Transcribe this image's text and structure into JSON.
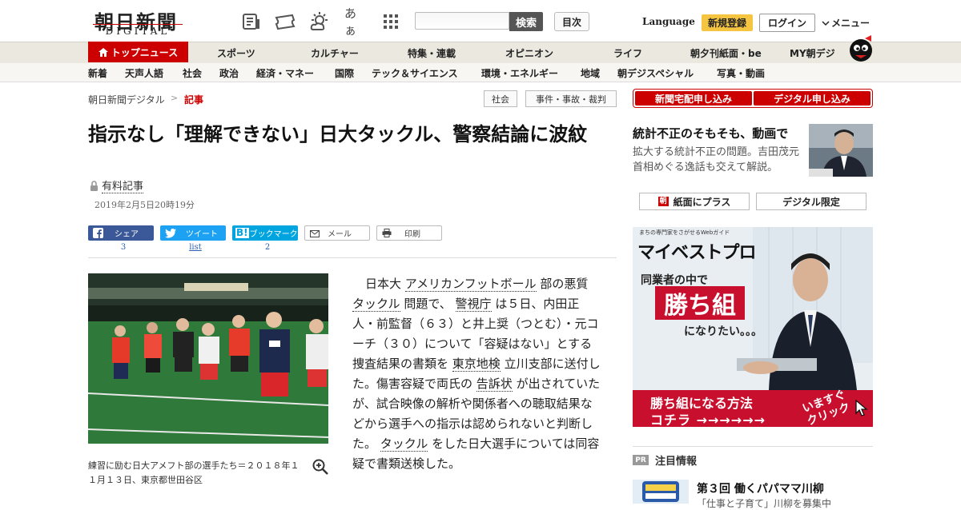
{
  "header": {
    "logo_ja": "朝日新聞",
    "logo_en": "DIGITAL",
    "search_button": "検索",
    "toc_button": "目次",
    "language": "Language",
    "register": "新規登録",
    "login": "ログイン",
    "menu": "メニュー",
    "icon_names": [
      "newspaper-icon",
      "ticket-icon",
      "weather-icon",
      "font-size-icon",
      "grid-apps-icon"
    ],
    "font_icon_text": "あぁ"
  },
  "nav_primary": [
    "トップニュース",
    "スポーツ",
    "カルチャー",
    "特集・連載",
    "オピニオン",
    "ライフ",
    "朝夕刊紙面・be",
    "MY朝デジ"
  ],
  "nav_secondary": [
    "新着",
    "天声人語",
    "社会",
    "政治",
    "経済・マネー",
    "国際",
    "テック＆サイエンス",
    "環境・エネルギー",
    "地域",
    "朝デジスペシャル",
    "写真・動画"
  ],
  "breadcrumb": {
    "home": "朝日新聞デジタル",
    "separator": ">",
    "current": "記事"
  },
  "tags": [
    "社会",
    "事件・事故・裁判"
  ],
  "article": {
    "headline": "指示なし「理解できない」日大タックル、警察結論に波紋",
    "paid_label": "有料記事",
    "date": "2019年2月5日20時19分",
    "share": [
      {
        "label": "シェア",
        "count": "3"
      },
      {
        "label": "ツイート",
        "count": "list"
      },
      {
        "label": "ブックマーク",
        "count": "2"
      }
    ],
    "mail": "メール",
    "print": "印刷",
    "photo_caption": "練習に励む日大アメフト部の選手たち＝２０１８年１１月１３日、東京都世田谷区",
    "body": {
      "p1": "日本大",
      "k1": "アメリカンフットボール",
      "p2": "部の悪質",
      "k2": "タックル",
      "p3": "問題で、",
      "k3": "警視庁",
      "p4": "は５日、内田正人・前監督（６３）と井上奨（つとむ）・元コーチ（３０）について「容疑はない」とする捜査結果の書類を",
      "k4": "東京地検",
      "p5": "立川支部に送付した。傷害容疑で両氏の",
      "k5": "告訴状",
      "p6": "が出されていたが、試合映像の解析や関係者への聴取結果などから選手への指示は認められないと判断した。",
      "k6": "タックル",
      "p7": "をした日大選手については同容疑で書類送検した。"
    }
  },
  "sidebar": {
    "subscribe_home": "新聞宅配申し込み",
    "subscribe_digital": "デジタル申し込み",
    "promo_title": "統計不正のそもそも、動画で",
    "promo_desc": "拡大する統計不正の問題。吉田茂元首相めぐる逸話も交えて解説。",
    "plus_button": "紙面にプラス",
    "digital_only": "デジタル限定",
    "ad": {
      "tagline": "まちの専門家をさがせるWebガイド",
      "brand": "マイベストプロ",
      "line1": "同業者の中で",
      "win": "勝ち組",
      "line2": "になりたい。。。",
      "cta1": "勝ち組になる方法",
      "cta2": "コチラ →→→→→→",
      "cta3": "いますぐクリック"
    },
    "pr_badge": "PR",
    "attention": "注目情報",
    "pr_title": "第３回 働くパパママ川柳",
    "pr_sub": "「仕事と子育て」川柳を募集中"
  },
  "colors": {
    "brand_red": "#cc0000",
    "facebook": "#3b5998",
    "twitter": "#1da1f2",
    "hatena": "#00a4de",
    "register_yellow": "#f5c542"
  }
}
